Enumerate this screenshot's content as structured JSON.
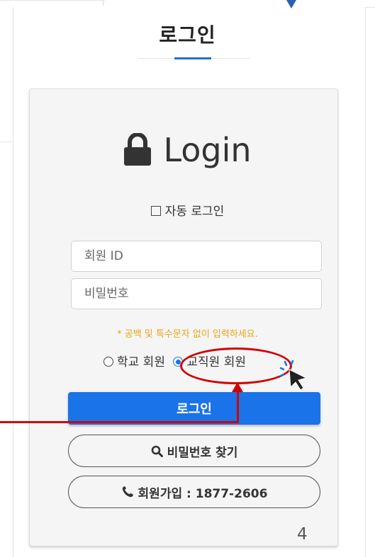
{
  "page": {
    "title": "로그인",
    "page_number": "4"
  },
  "login_card": {
    "heading": "Login",
    "lock_icon": "lock-icon",
    "auto_login_label": "자동 로그인",
    "id_placeholder": "회원 ID",
    "password_placeholder": "비밀번호",
    "notice": "* 공백 및 특수문자 없이 입력하세요.",
    "member_types": [
      {
        "label": "학교 회원",
        "selected": false
      },
      {
        "label": "교직원 회원",
        "selected": true
      }
    ],
    "login_button": "로그인",
    "find_password_button": "비밀번호 찾기",
    "signup_button": "회원가입 : 1877-2606",
    "search_icon": "search-icon",
    "phone_icon": "phone-icon"
  },
  "colors": {
    "accent": "#1a73e8",
    "notice": "#e6a617",
    "annotation": "#d10000",
    "card_bg": "#f5f5f5"
  }
}
